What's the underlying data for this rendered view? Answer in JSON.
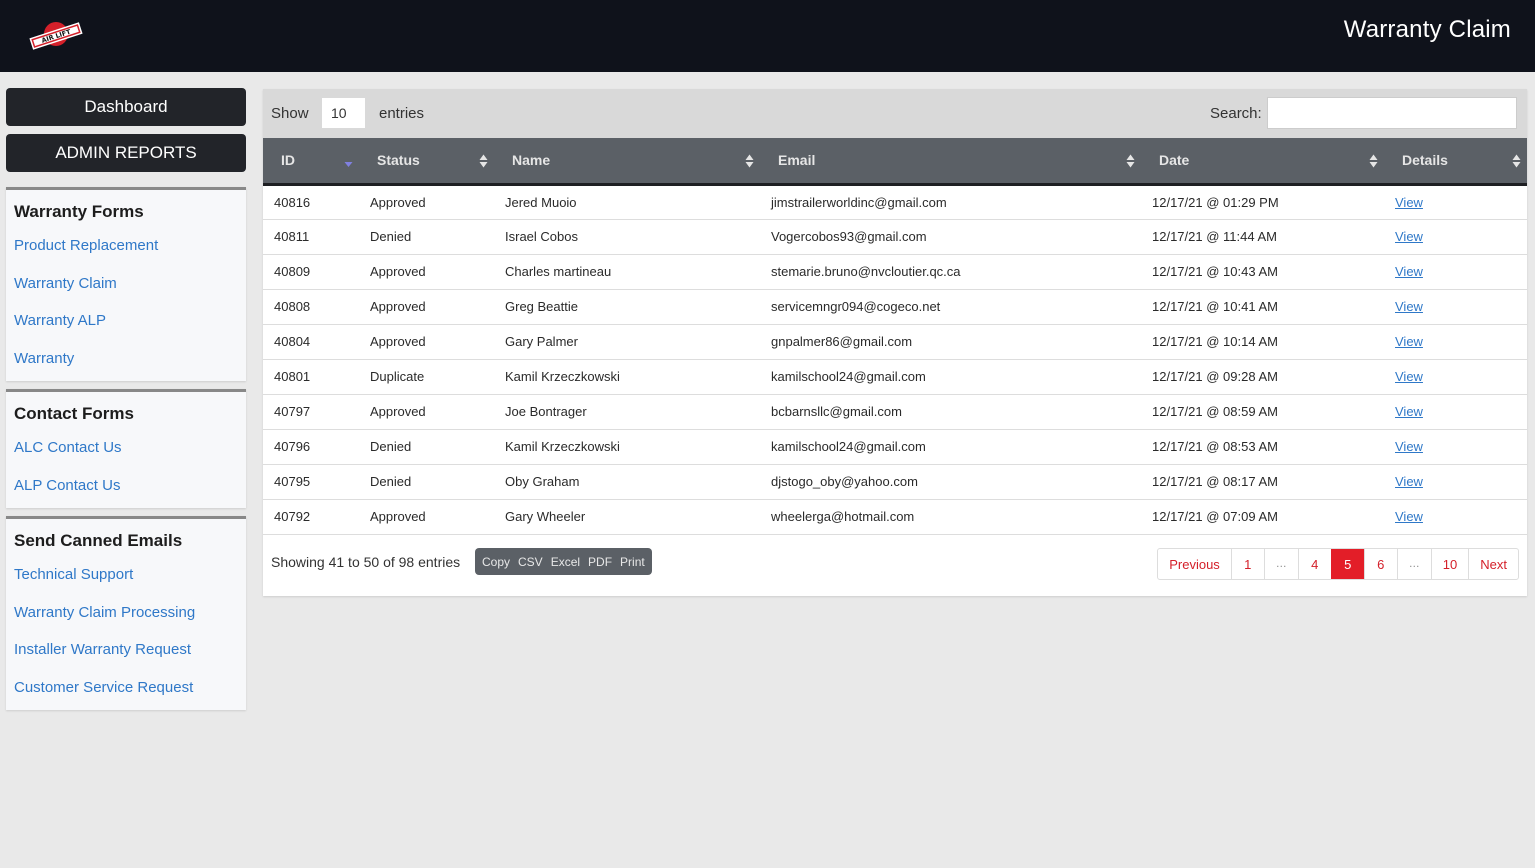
{
  "header": {
    "logo_text": "AIR LIFT",
    "title": "Warranty Claim"
  },
  "sidebar": {
    "buttons": [
      {
        "label": "Dashboard"
      },
      {
        "label": "ADMIN REPORTS"
      }
    ],
    "sections": [
      {
        "title": "Warranty Forms",
        "links": [
          "Product Replacement",
          "Warranty Claim",
          "Warranty ALP",
          "Warranty"
        ]
      },
      {
        "title": "Contact Forms",
        "links": [
          "ALC Contact Us",
          "ALP Contact Us"
        ]
      },
      {
        "title": "Send Canned Emails",
        "links": [
          "Technical Support",
          "Warranty Claim Processing",
          "Installer Warranty Request",
          "Customer Service Request"
        ]
      }
    ]
  },
  "toolbar": {
    "show_label": "Show",
    "page_length": "10",
    "entries_label": "entries",
    "search_label": "Search:",
    "search_value": ""
  },
  "table": {
    "columns": [
      "ID",
      "Status",
      "Name",
      "Email",
      "Date",
      "Details"
    ],
    "sorted_column": "ID",
    "sort_direction": "descending",
    "rows": [
      {
        "id": "40816",
        "status": "Approved",
        "name": "Jered Muoio",
        "email": "jimstrailerworldinc@gmail.com",
        "date": "12/17/21 @ 01:29 PM",
        "details": "View"
      },
      {
        "id": "40811",
        "status": "Denied",
        "name": "Israel Cobos",
        "email": "Vogercobos93@gmail.com",
        "date": "12/17/21 @ 11:44 AM",
        "details": "View"
      },
      {
        "id": "40809",
        "status": "Approved",
        "name": "Charles martineau",
        "email": "stemarie.bruno@nvcloutier.qc.ca",
        "date": "12/17/21 @ 10:43 AM",
        "details": "View"
      },
      {
        "id": "40808",
        "status": "Approved",
        "name": "Greg Beattie",
        "email": "servicemngr094@cogeco.net",
        "date": "12/17/21 @ 10:41 AM",
        "details": "View"
      },
      {
        "id": "40804",
        "status": "Approved",
        "name": "Gary Palmer",
        "email": "gnpalmer86@gmail.com",
        "date": "12/17/21 @ 10:14 AM",
        "details": "View"
      },
      {
        "id": "40801",
        "status": "Duplicate",
        "name": "Kamil Krzeczkowski",
        "email": "kamilschool24@gmail.com",
        "date": "12/17/21 @ 09:28 AM",
        "details": "View"
      },
      {
        "id": "40797",
        "status": "Approved",
        "name": "Joe Bontrager",
        "email": "bcbarnsllc@gmail.com",
        "date": "12/17/21 @ 08:59 AM",
        "details": "View"
      },
      {
        "id": "40796",
        "status": "Denied",
        "name": "Kamil Krzeczkowski",
        "email": "kamilschool24@gmail.com",
        "date": "12/17/21 @ 08:53 AM",
        "details": "View"
      },
      {
        "id": "40795",
        "status": "Denied",
        "name": "Oby Graham",
        "email": "djstogo_oby@yahoo.com",
        "date": "12/17/21 @ 08:17 AM",
        "details": "View"
      },
      {
        "id": "40792",
        "status": "Approved",
        "name": "Gary Wheeler",
        "email": "wheelerga@hotmail.com",
        "date": "12/17/21 @ 07:09 AM",
        "details": "View"
      }
    ]
  },
  "footer": {
    "info": "Showing 41 to 50 of 98 entries",
    "export_buttons": [
      "Copy",
      "CSV",
      "Excel",
      "PDF",
      "Print"
    ],
    "pagination": {
      "previous": "Previous",
      "pages": [
        "1",
        "…",
        "4",
        "5",
        "6",
        "…",
        "10"
      ],
      "active": "5",
      "next": "Next"
    }
  },
  "colors": {
    "header_bg": "#0f121b",
    "accent_red": "#e31e28",
    "link_blue": "#2f78c8",
    "table_header_bg": "#5b6066",
    "sort_active": "#8080e0"
  }
}
